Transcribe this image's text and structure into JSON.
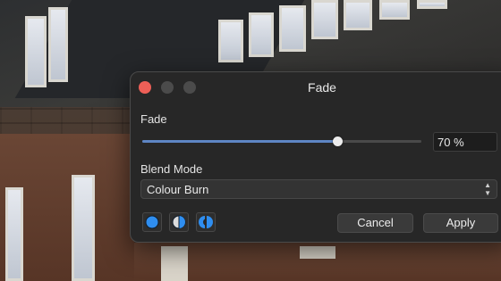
{
  "dialog": {
    "title": "Fade",
    "fade_label": "Fade",
    "fade_value": 70,
    "fade_value_text": "70 %",
    "blend_mode_label": "Blend Mode",
    "blend_mode_value": "Colour Burn",
    "cancel_label": "Cancel",
    "apply_label": "Apply",
    "preview_modes": [
      "full-preview-icon",
      "split-preview-icon",
      "mirror-preview-icon"
    ]
  },
  "colors": {
    "accent": "#5e86c4",
    "close_button": "#ee5f57",
    "mode_icon_blue": "#2f8ef0",
    "panel_background": "#272727"
  }
}
